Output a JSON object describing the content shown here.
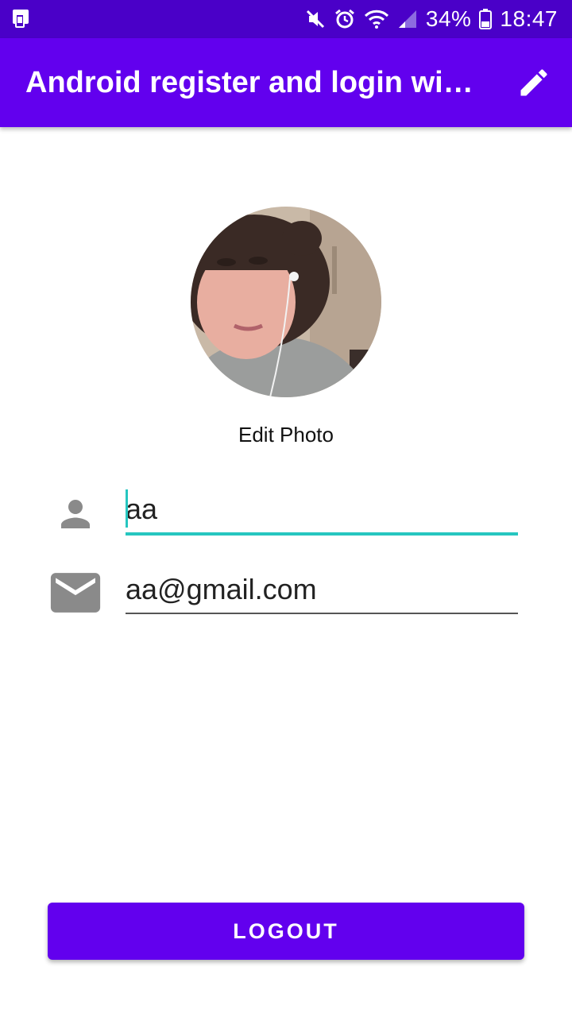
{
  "status_bar": {
    "battery": "34%",
    "time": "18:47",
    "icons": [
      "notification-icon",
      "mute-icon",
      "alarm-icon",
      "wifi-icon",
      "signal-icon",
      "battery-icon"
    ]
  },
  "app_bar": {
    "title": "Android register and login wi…",
    "action_icon": "edit-icon"
  },
  "profile": {
    "edit_photo_label": "Edit Photo"
  },
  "form": {
    "name_value": "aa",
    "name_icon": "person-icon",
    "email_value": "aa@gmail.com",
    "email_icon": "mail-icon"
  },
  "actions": {
    "logout_label": "LOGOUT"
  },
  "colors": {
    "status_bar": "#4A00C8",
    "primary": "#6200EE",
    "accent": "#26C6C0",
    "icon_gray": "#8A8A8A"
  }
}
